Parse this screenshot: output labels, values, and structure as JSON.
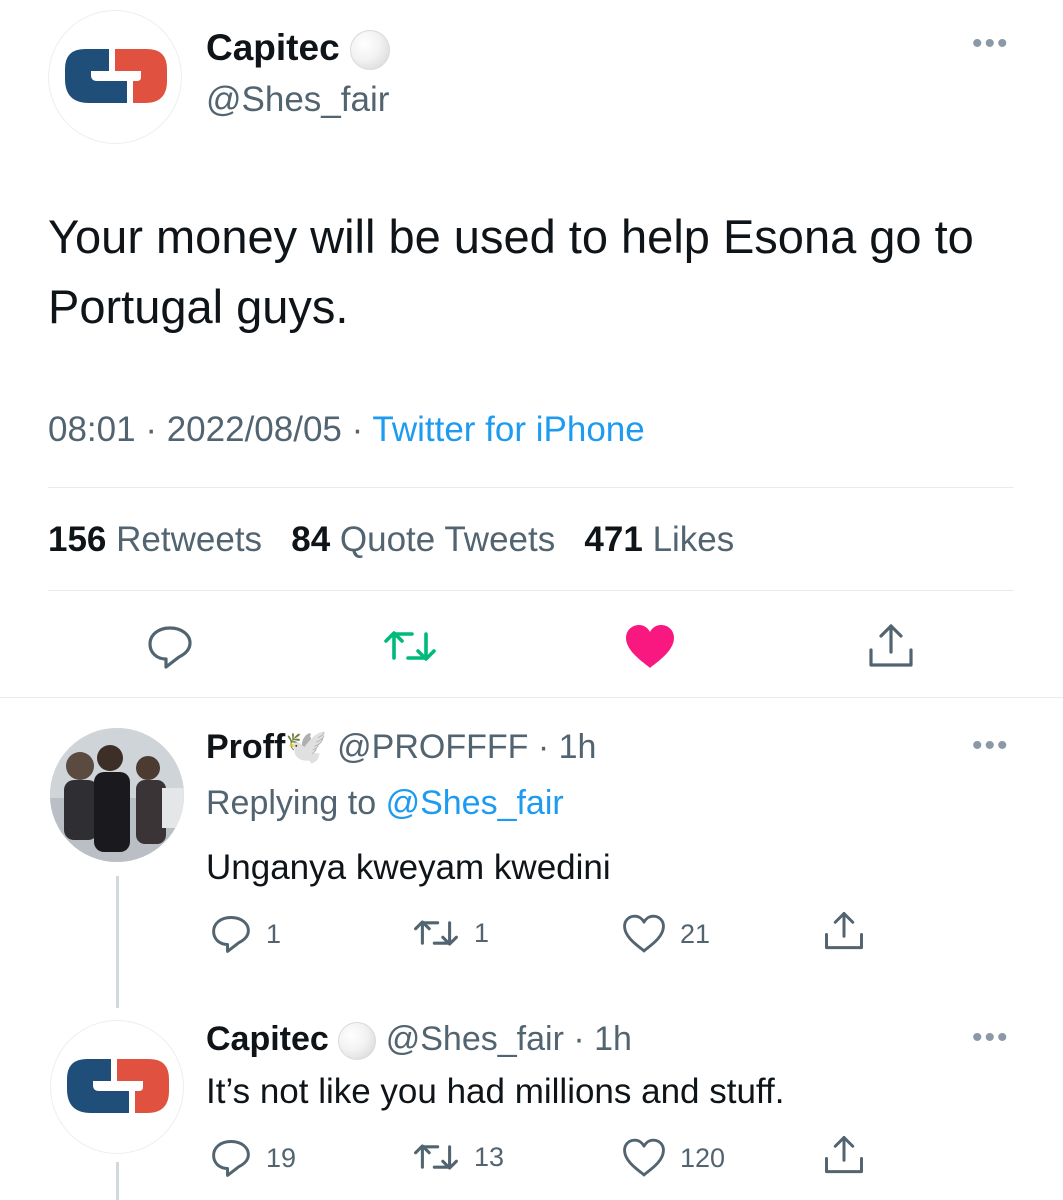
{
  "main_tweet": {
    "display_name": "Capitec",
    "handle": "@Shes_fair",
    "text": "Your money will be used to help Esona go to Portugal guys.",
    "time": "08:01",
    "date": "2022/08/05",
    "source": "Twitter for iPhone",
    "separator": "·",
    "retweets_count": "156",
    "retweets_label": "Retweets",
    "quotes_count": "84",
    "quotes_label": "Quote Tweets",
    "likes_count": "471",
    "likes_label": "Likes",
    "liked": true,
    "colors": {
      "retweet": "#00ba7c",
      "like": "#f91880",
      "link": "#1d9bf0"
    }
  },
  "replies": [
    {
      "display_name": "Proff",
      "name_emoji": "🕊️",
      "handle": "@PROFFFF",
      "time": "1h",
      "replying_label": "Replying to",
      "replying_to": "@Shes_fair",
      "text": "Unganya kweyam kwedini",
      "reply_count": "1",
      "retweet_count": "1",
      "like_count": "21"
    },
    {
      "display_name": "Capitec",
      "handle": "@Shes_fair",
      "time": "1h",
      "text": "It’s not like you had millions and stuff.",
      "reply_count": "19",
      "retweet_count": "13",
      "like_count": "120"
    }
  ],
  "icons": [
    "capitec-logo-icon",
    "verified-badge-icon",
    "more-icon",
    "reply-icon",
    "retweet-icon",
    "like-icon",
    "share-icon"
  ]
}
